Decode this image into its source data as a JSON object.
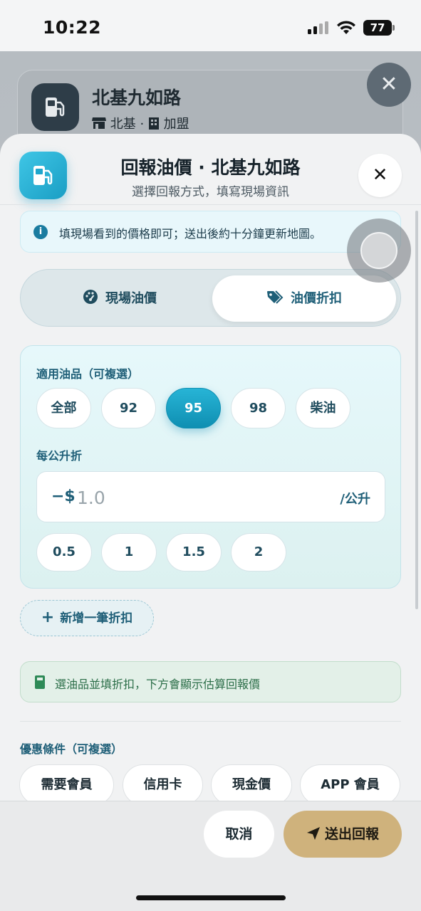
{
  "status_bar": {
    "time": "10:22",
    "battery": "77"
  },
  "background": {
    "station_name": "北基九如路",
    "meta_area": "北基",
    "meta_sep": "·",
    "meta_type": "加盟"
  },
  "sheet": {
    "title": "回報油價 · 北基九如路",
    "subtitle": "選擇回報方式，填寫現場資訊",
    "info_text": "填現場看到的價格即可；送出後約十分鐘更新地圖。",
    "tabs": [
      {
        "label": "現場油價",
        "active": false
      },
      {
        "label": "油價折扣",
        "active": true
      }
    ],
    "fuel_label": "適用油品（可複選）",
    "fuel_options": [
      {
        "label": "全部",
        "selected": false
      },
      {
        "label": "92",
        "selected": false
      },
      {
        "label": "95",
        "selected": true
      },
      {
        "label": "98",
        "selected": false
      },
      {
        "label": "柴油",
        "selected": false
      }
    ],
    "discount_label": "每公升折",
    "amount_prefix": "−$",
    "amount_placeholder": "1.0",
    "amount_unit": "/公升",
    "quick_amounts": [
      "0.5",
      "1",
      "1.5",
      "2"
    ],
    "add_discount": "新增一筆折扣",
    "hint_text": "選油品並填折扣，下方會顯示估算回報價",
    "conditions_label": "優惠條件（可複選）",
    "conditions": [
      "需要會員",
      "信用卡",
      "現金價",
      "APP 會員"
    ],
    "cancel_label": "取消",
    "submit_label": "送出回報"
  },
  "colors": {
    "accent": "#1a9ec4",
    "primary_text": "#1f5f78",
    "submit": "#cfb27c",
    "hint_green": "#2a6d47"
  },
  "icons": [
    "fuel-pump-icon",
    "close-icon",
    "info-icon",
    "gauge-icon",
    "tag-icon",
    "plus-icon",
    "calculator-icon",
    "send-icon",
    "store-icon",
    "building-icon"
  ]
}
